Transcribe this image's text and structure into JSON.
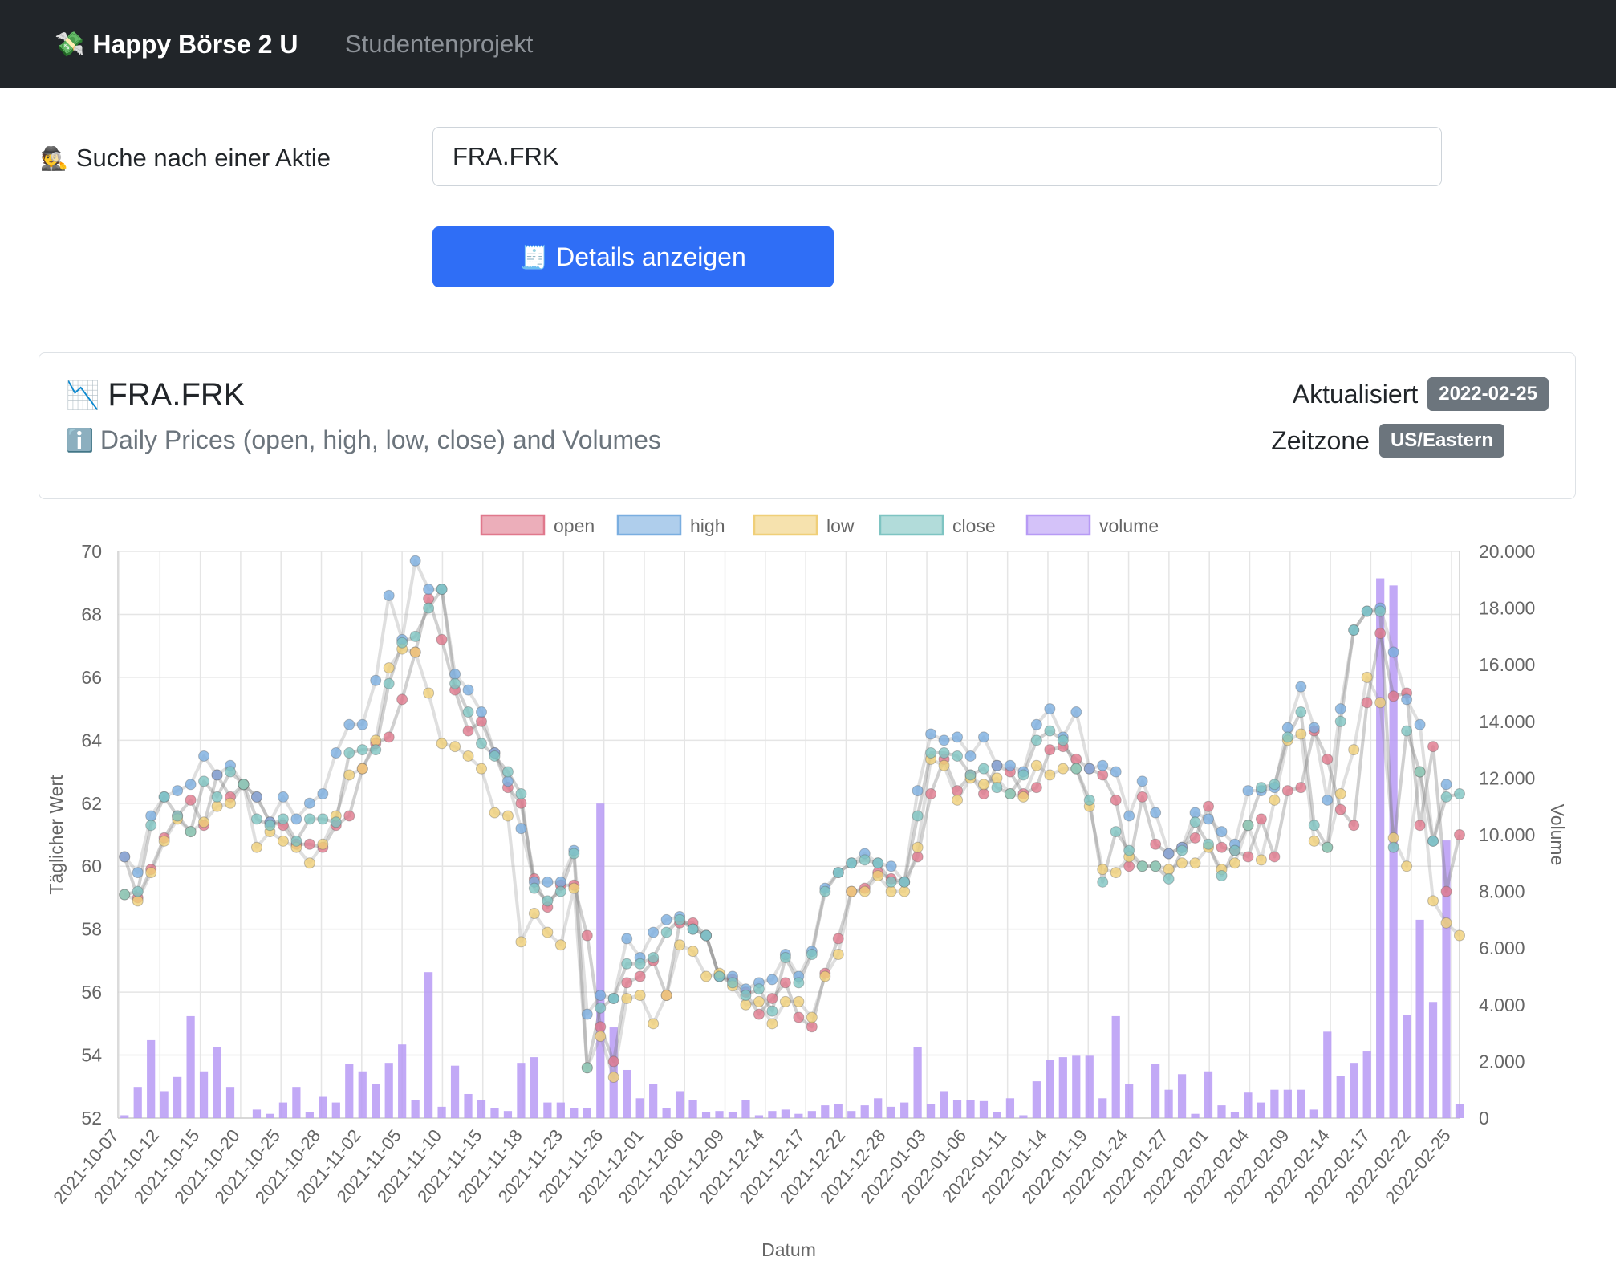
{
  "navbar": {
    "brand_icon": "💸",
    "brand": "Happy Börse 2 U",
    "link": "Studentenprojekt"
  },
  "search": {
    "icon": "🕵️",
    "label": "Suche nach einer Aktie",
    "value": "FRA.FRK",
    "button_icon": "🧾",
    "button_label": "Details anzeigen"
  },
  "card": {
    "title_icon": "📉",
    "title": "FRA.FRK",
    "subtitle_icon": "ℹ️",
    "subtitle": "Daily Prices (open, high, low, close) and Volumes",
    "updated_label": "Aktualisiert",
    "updated_value": "2022-02-25",
    "timezone_label": "Zeitzone",
    "timezone_value": "US/Eastern"
  },
  "chart_data": {
    "type": "line",
    "xlabel": "Datum",
    "ylabel": "Täglicher Wert",
    "y2label": "Volume",
    "ylim": [
      52,
      70
    ],
    "y2lim": [
      0,
      20000
    ],
    "yticks": [
      "52",
      "54",
      "56",
      "58",
      "60",
      "62",
      "64",
      "66",
      "68",
      "70"
    ],
    "y2ticks": [
      "0",
      "2.000",
      "4.000",
      "6.000",
      "8.000",
      "10.000",
      "12.000",
      "14.000",
      "16.000",
      "18.000",
      "20.000"
    ],
    "grid": true,
    "legend_position": "top",
    "xtick_labels": [
      "2021-10-07",
      "2021-10-12",
      "2021-10-15",
      "2021-10-20",
      "2021-10-25",
      "2021-10-28",
      "2021-11-02",
      "2021-11-05",
      "2021-11-10",
      "2021-11-15",
      "2021-11-18",
      "2021-11-23",
      "2021-11-26",
      "2021-12-01",
      "2021-12-06",
      "2021-12-09",
      "2021-12-14",
      "2021-12-17",
      "2021-12-22",
      "2021-12-28",
      "2022-01-03",
      "2022-01-06",
      "2022-01-11",
      "2022-01-14",
      "2022-01-19",
      "2022-01-24",
      "2022-01-27",
      "2022-02-01",
      "2022-02-04",
      "2022-02-09",
      "2022-02-14",
      "2022-02-17",
      "2022-02-22",
      "2022-02-25"
    ],
    "series": [
      {
        "name": "open",
        "color": "#e0788c",
        "values": [
          60.3,
          59,
          59.9,
          60.9,
          61.6,
          62.1,
          61.3,
          62.9,
          62.2,
          62.6,
          62.2,
          61.4,
          61.3,
          60.7,
          60.7,
          60.6,
          61.3,
          61.6,
          63.1,
          63.9,
          64.1,
          65.3,
          66.8,
          68.5,
          67.2,
          65.6,
          64.3,
          64.6,
          63.6,
          62.5,
          62,
          59.6,
          58.7,
          59.4,
          59.4,
          57.8,
          54.9,
          53.8,
          56.3,
          56.5,
          57,
          55.9,
          58.2,
          58.2,
          57.8,
          56.5,
          56.4,
          56,
          55.3,
          55.8,
          56.3,
          55.2,
          54.9,
          56.6,
          57.7,
          59.2,
          59.3,
          59.8,
          59.6,
          59.5,
          60.3,
          62.3,
          63.4,
          62.4,
          62.9,
          62.3,
          63.2,
          63,
          62.3,
          62.5,
          63.7,
          63.8,
          63.4,
          63.1,
          62.9,
          62.1,
          60,
          62.2,
          60.7,
          60.4,
          60.6,
          60.9,
          61.9,
          60.6,
          60.5,
          60.3,
          61.5,
          60.3,
          62.4,
          62.5,
          64.3,
          63.4,
          61.8,
          61.3,
          65.2,
          67.4,
          65.4,
          65.5,
          61.3,
          63.8,
          59.2,
          61
        ],
        "name_label": "open"
      },
      {
        "name": "high",
        "color": "#7aaee0",
        "values": [
          60.3,
          59.8,
          61.6,
          62.2,
          62.4,
          62.6,
          63.5,
          62.9,
          63.2,
          62.6,
          62.2,
          61.4,
          62.2,
          61.5,
          62,
          62.3,
          63.6,
          64.5,
          64.5,
          65.9,
          68.6,
          67.2,
          69.7,
          68.8,
          68.8,
          66.1,
          65.6,
          64.9,
          63.6,
          62.7,
          61.2,
          59.5,
          59.5,
          59.5,
          60.5,
          55.3,
          55.9,
          55.8,
          57.7,
          57.1,
          57.9,
          58.3,
          58.4,
          58,
          57.8,
          56.5,
          56.5,
          56.1,
          56.3,
          56.4,
          57.2,
          56.5,
          57.3,
          59.3,
          59.8,
          60.1,
          60.4,
          60.1,
          60,
          59.5,
          62.4,
          64.2,
          64,
          64.1,
          63.5,
          64.1,
          63.2,
          63.2,
          63,
          64.5,
          65,
          64.1,
          64.9,
          63.1,
          63.2,
          63,
          61.6,
          62.7,
          61.7,
          60.4,
          60.6,
          61.7,
          61.5,
          61.1,
          60.7,
          62.4,
          62.4,
          62.5,
          64.4,
          65.7,
          64.4,
          62.1,
          65,
          67.5,
          68.1,
          68.2,
          66.8,
          65.3,
          64.5,
          60.8,
          62.6
        ],
        "name_label": "high"
      },
      {
        "name": "low",
        "color": "#f0cf78",
        "values": [
          59.1,
          58.9,
          59.8,
          60.8,
          61.5,
          61.1,
          61.4,
          61.9,
          62,
          62.6,
          60.6,
          61.1,
          60.8,
          60.6,
          60.1,
          60.7,
          61.6,
          62.9,
          63.1,
          64,
          66.3,
          66.9,
          66.8,
          65.5,
          63.9,
          63.8,
          63.5,
          63.1,
          61.7,
          61.6,
          57.6,
          58.5,
          57.9,
          57.5,
          59.3,
          53.6,
          54.6,
          53.3,
          55.8,
          55.9,
          55,
          55.9,
          57.5,
          57.3,
          56.5,
          56.6,
          56.2,
          55.6,
          55.7,
          55,
          55.7,
          55.7,
          55.2,
          56.5,
          57.2,
          59.2,
          59.2,
          59.7,
          59.2,
          59.2,
          60.6,
          63.4,
          63.2,
          62.1,
          62.8,
          62.6,
          62.8,
          62.3,
          62.2,
          63.2,
          62.9,
          63.1,
          63.1,
          61.9,
          59.9,
          59.8,
          60.3,
          60,
          60,
          59.9,
          60.1,
          60.1,
          60.6,
          59.9,
          60.1,
          61.3,
          60.2,
          62.1,
          64,
          64.2,
          60.8,
          60.6,
          62.3,
          63.7,
          66,
          65.2,
          60.9,
          60,
          63,
          58.9,
          58.2,
          57.8
        ],
        "name_label": "low"
      },
      {
        "name": "close",
        "color": "#7ec4c2",
        "values": [
          59.1,
          59.2,
          61.3,
          62.2,
          61.6,
          61.1,
          62.7,
          62.2,
          63,
          62.6,
          61.5,
          61.3,
          61.5,
          60.8,
          61.5,
          61.5,
          61.4,
          63.6,
          63.7,
          63.7,
          65.8,
          67.1,
          67.3,
          68.2,
          68.8,
          65.8,
          64.9,
          63.9,
          63.5,
          63,
          62.3,
          59.3,
          58.9,
          59.2,
          60.4,
          53.6,
          55.5,
          55.8,
          56.9,
          56.9,
          57.1,
          57.9,
          58.3,
          58,
          57.8,
          56.5,
          56.3,
          55.9,
          56.1,
          55.4,
          57.1,
          56.3,
          57.2,
          59.2,
          59.8,
          60.1,
          60.2,
          60.1,
          59.5,
          59.5,
          61.6,
          63.6,
          63.6,
          63.5,
          62.9,
          63.1,
          62.5,
          62.3,
          62.9,
          64,
          64.3,
          64,
          63.1,
          62.1,
          59.5,
          61.1,
          60.5,
          60,
          60,
          59.6,
          60.5,
          61.4,
          60.7,
          59.7,
          60.5,
          61.3,
          62.5,
          62.6,
          64.1,
          64.9,
          61.3,
          60.6,
          64.6,
          67.5,
          68.1,
          68.1,
          60.6,
          64.3,
          63,
          60.8,
          62.2,
          62.3
        ],
        "name_label": "close"
      },
      {
        "name": "volume",
        "color": "#b79af5",
        "values": [
          100,
          1100,
          2750,
          950,
          1450,
          3600,
          1650,
          2500,
          1100,
          0,
          300,
          150,
          550,
          1100,
          200,
          750,
          550,
          1900,
          1650,
          1200,
          1950,
          2600,
          650,
          5150,
          400,
          1850,
          850,
          650,
          350,
          250,
          1950,
          2150,
          550,
          550,
          350,
          350,
          11100,
          3200,
          1700,
          700,
          1200,
          350,
          950,
          650,
          200,
          250,
          200,
          650,
          100,
          250,
          300,
          150,
          250,
          450,
          500,
          250,
          450,
          700,
          400,
          550,
          2500,
          500,
          950,
          650,
          650,
          600,
          200,
          700,
          100,
          1300,
          2050,
          2150,
          2200,
          2200,
          700,
          3600,
          1200,
          0,
          1900,
          1000,
          1550,
          150,
          1650,
          450,
          200,
          900,
          550,
          1000,
          1000,
          1000,
          300,
          3050,
          1500,
          1950,
          2350,
          19050,
          18800,
          3650,
          7000,
          4100,
          9800,
          500
        ],
        "name_label": "volume"
      }
    ]
  }
}
